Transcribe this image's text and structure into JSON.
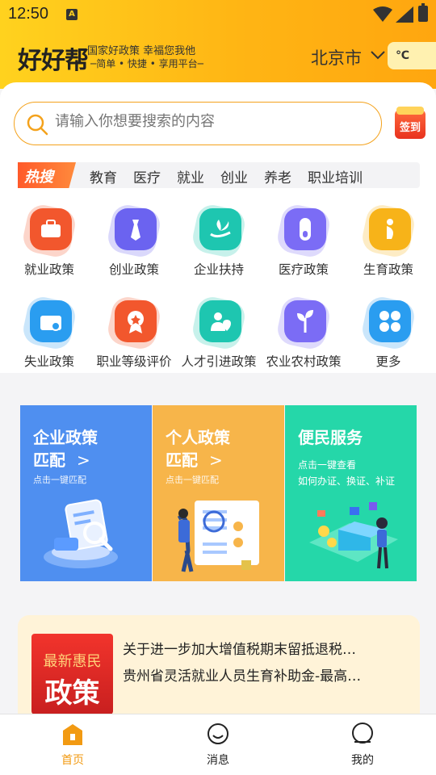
{
  "status": {
    "time": "12:50",
    "notif_icon": "A"
  },
  "header": {
    "logo": "好好帮",
    "slogan_line1": "国家好政策 幸福您我他",
    "slogan_line2": "─简单 • 快捷 • 享用平台─",
    "city": "北京市",
    "weather": "℃"
  },
  "search": {
    "placeholder": "请输入你想要搜索的内容",
    "signin_label": "签到"
  },
  "hot": {
    "badge": "热搜",
    "items": [
      "教育",
      "医疗",
      "就业",
      "创业",
      "养老",
      "职业培训"
    ]
  },
  "categories": [
    {
      "label": "就业政策",
      "icon": "briefcase-icon",
      "color": "#f2572d"
    },
    {
      "label": "创业政策",
      "icon": "tie-icon",
      "color": "#6b63f0"
    },
    {
      "label": "企业扶持",
      "icon": "plant-hand-icon",
      "color": "#1ec6b0"
    },
    {
      "label": "医疗政策",
      "icon": "capsule-icon",
      "color": "#7b6cf5"
    },
    {
      "label": "生育政策",
      "icon": "pregnant-icon",
      "color": "#f7b319"
    },
    {
      "label": "失业政策",
      "icon": "briefcase-search-icon",
      "color": "#2a9df0"
    },
    {
      "label": "职业等级评价",
      "icon": "award-icon",
      "color": "#f2572d"
    },
    {
      "label": "人才引进政策",
      "icon": "person-location-icon",
      "color": "#1ec6b0"
    },
    {
      "label": "农业农村政策",
      "icon": "sprout-icon",
      "color": "#7b6cf5"
    },
    {
      "label": "更多",
      "icon": "grid-more-icon",
      "color": "#2a9df0"
    }
  ],
  "cards": [
    {
      "title1": "企业政策",
      "title2": "匹配",
      "arrow": ">",
      "sub": "点击一键匹配",
      "color": "#4f8ff0"
    },
    {
      "title1": "个人政策",
      "title2": "匹配",
      "arrow": ">",
      "sub": "点击一键匹配",
      "color": "#f7b54a"
    },
    {
      "title1": "便民服务",
      "sub1": "点击一键查看",
      "sub2": "如何办证、换证、补证",
      "color": "#25d7a9"
    }
  ],
  "news": {
    "badge_line1": "最新惠民",
    "badge_line2": "政策",
    "items": [
      "关于进一步加大增值税期末留抵退税…",
      "贵州省灵活就业人员生育补助金-最高…"
    ]
  },
  "nav": [
    {
      "label": "首页",
      "icon": "home-icon",
      "active": true
    },
    {
      "label": "消息",
      "icon": "chat-icon",
      "active": false
    },
    {
      "label": "我的",
      "icon": "profile-icon",
      "active": false
    }
  ]
}
